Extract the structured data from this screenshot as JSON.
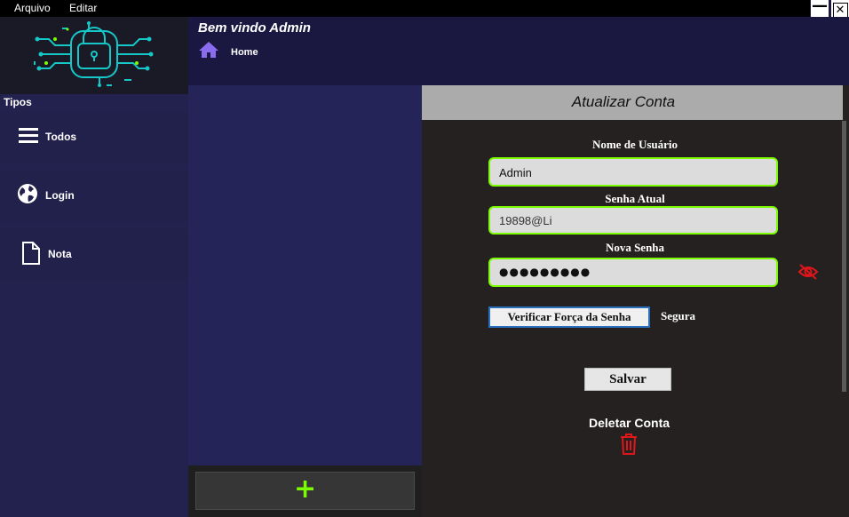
{
  "menu": {
    "items": [
      "Arquivo",
      "Editar"
    ]
  },
  "window": {
    "minimize": "—",
    "close": "✕"
  },
  "header": {
    "welcome": "Bem vindo Admin",
    "breadcrumb": "Home"
  },
  "sidebar": {
    "title": "Tipos",
    "items": [
      {
        "label": "Todos",
        "icon": "list-icon"
      },
      {
        "label": "Login",
        "icon": "globe-icon"
      },
      {
        "label": "Nota",
        "icon": "document-icon"
      }
    ]
  },
  "middle": {
    "add_label": "+"
  },
  "form": {
    "title": "Atualizar Conta",
    "username_label": "Nome de Usuário",
    "username_value": "Admin",
    "current_password_label": "Senha Atual",
    "current_password_value": "19898@Li",
    "new_password_label": "Nova Senha",
    "new_password_value": "●●●●●●●●●",
    "check_strength_label": "Verificar Força da Senha",
    "strength_value": "Segura",
    "save_label": "Salvar",
    "delete_label": "Deletar Conta"
  },
  "colors": {
    "accent": "#7cfc00",
    "danger": "#e0161b",
    "icon_purple": "#8a6cf0",
    "logo_cyan": "#16c7c7"
  }
}
